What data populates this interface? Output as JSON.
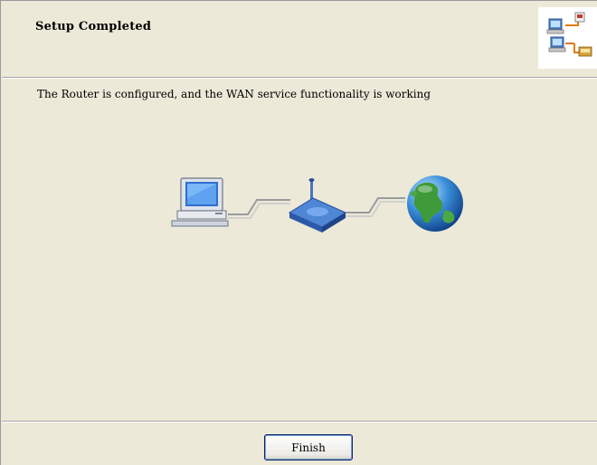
{
  "header": {
    "title": "Setup Completed",
    "icon": "network-wizard-icon"
  },
  "main": {
    "message": "The Router is configured, and the WAN service functionality is working",
    "diagram": {
      "left_icon": "computer-icon",
      "middle_icon": "router-icon",
      "right_icon": "globe-icon"
    }
  },
  "footer": {
    "finish_label": "Finish"
  },
  "colors": {
    "background": "#ece9d8",
    "button_border": "#0a246a",
    "separator": "#a7a6aa"
  }
}
